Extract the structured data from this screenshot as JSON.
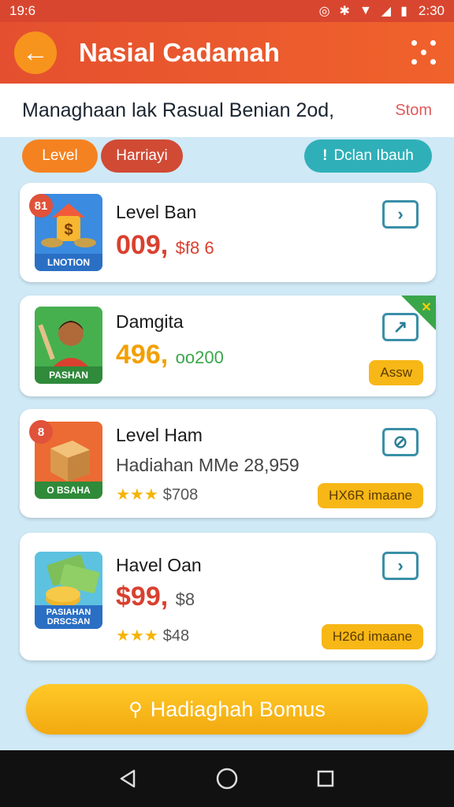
{
  "status_bar": {
    "time": "19:6",
    "clock_right": "2:30"
  },
  "app_bar": {
    "title": "Nasial Cadamah"
  },
  "subheader": {
    "text": "Managhaan lak Rasual Benian 2od,",
    "link": "Stom"
  },
  "chips": {
    "level": "Level",
    "hadiah": "Harriayi",
    "teal": "Dclan Ibauh"
  },
  "cards": [
    {
      "badge": "81",
      "tag": "LNOTION",
      "title": "Level Ban",
      "price_main": "009,",
      "price_rest": "$f8  6",
      "price_color": "#d9402f"
    },
    {
      "tag": "PASHAN",
      "title": "Damgita",
      "price_main": "496,",
      "price_rest": "oo200",
      "price_color": "#f2a000",
      "pill": "Assw"
    },
    {
      "badge": "8",
      "tag": "O BSAHA",
      "title": "Level Ham",
      "line2": "Hadiahan MMe 28,959",
      "stars_value": "$708",
      "pill": "HX6R imaane"
    },
    {
      "tag": "PASIAHAN DRSCSAN",
      "title": "Havel Oan",
      "price_main": "$99,",
      "price_rest": "$8",
      "price_color": "#d9402f",
      "stars_value": "$48",
      "pill": "H26d imaane"
    }
  ],
  "cta": {
    "label": "Hadiaghah Bomus"
  }
}
